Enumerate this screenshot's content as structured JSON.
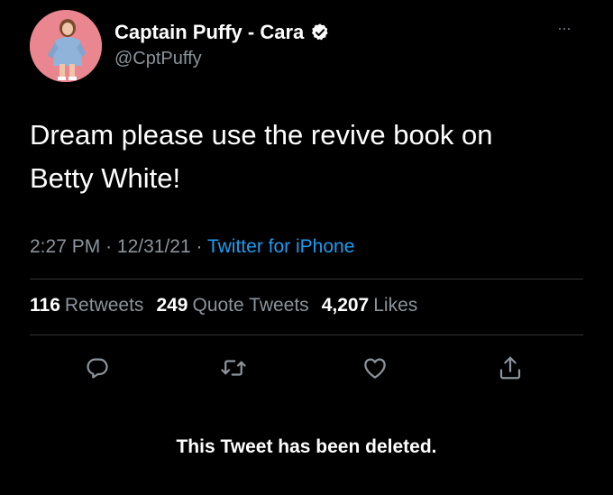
{
  "tweet": {
    "display_name": "Captain Puffy - Cara",
    "handle": "@CptPuffy",
    "text_line1": "Dream please use the revive book on",
    "text_line2": "Betty White!",
    "time": "2:27 PM",
    "date": "12/31/21",
    "separator": "·",
    "source": "Twitter for iPhone",
    "more_menu": "···"
  },
  "stats": {
    "retweets_count": "116",
    "retweets_label": "Retweets",
    "quotes_count": "249",
    "quotes_label": "Quote Tweets",
    "likes_count": "4,207",
    "likes_label": "Likes"
  },
  "actions": {
    "reply_icon": "reply-icon",
    "retweet_icon": "retweet-icon",
    "like_icon": "heart-icon",
    "share_icon": "share-icon"
  },
  "notice": {
    "deleted_text": "This Tweet has been deleted."
  },
  "colors": {
    "background": "#000000",
    "primary_text": "#ffffff",
    "secondary_text": "#8b949b",
    "link": "#1d9bf0",
    "divider": "#2f3336",
    "avatar_bg": "#e9868f"
  }
}
